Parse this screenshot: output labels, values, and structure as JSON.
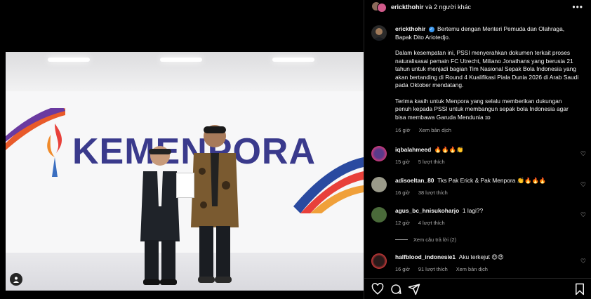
{
  "post": {
    "photo_brand_text": "KEMENPORA",
    "header": {
      "username": "erickthohir",
      "others_text": "và 2 người khác"
    },
    "caption": {
      "username": "erickthohir",
      "line1": "Bertemu dengan Menteri Pemuda dan Olahraga, Bapak Dito Ariotedjo.",
      "para2": "Dalam kesempatan ini, PSSI menyerahkan dokumen terkait proses naturalisasai pemain FC Utrecht, Miliano Jonathans yang berusia 21 tahun untuk menjadi bagian Tim Nasional Sepak Bola Indonesia yang akan bertanding di Round 4 Kualifikasi Piala Dunia 2026 di Arab Saudi pada Oktober mendatang.",
      "para3": "Terima kasih untuk Menpora yang selalu memberikan dukungan penuh kepada PSSI untuk membangun sepak bola Indonesia agar bisa membawa Garuda Mendunia ɪᴅ",
      "time": "16 giờ",
      "translate": "Xem bản dịch"
    }
  },
  "comments": [
    {
      "username": "iqbalahmeed",
      "text": "🔥🔥🔥👏",
      "time": "15 giờ",
      "likes": "5 lượt thích",
      "translate": ""
    },
    {
      "username": "adisoeltan_80",
      "text": "Tks Pak Erick & Pak Menpora 👏🔥🔥🔥",
      "time": "16 giờ",
      "likes": "38 lượt thích",
      "translate": ""
    },
    {
      "username": "agus_bc_hnisukoharjo",
      "text": "1 lagi??",
      "time": "12 giờ",
      "likes": "4 lượt thích",
      "translate": ""
    },
    {
      "username": "halfblood_indonesie1",
      "text": "Aku terkejut 😍😍",
      "time": "16 giờ",
      "likes": "91 lượt thích",
      "translate": "Xem bản dịch"
    }
  ],
  "replies": {
    "view_replies": "Xem câu trả lời (2)"
  },
  "icons": [
    "heart-icon",
    "comment-icon",
    "share-icon",
    "bookmark-icon",
    "more-icon",
    "user-tag-icon",
    "verified-badge-icon"
  ],
  "colors": {
    "accent": "#3897f0",
    "background": "#000000",
    "muted": "#a8a8a8",
    "brand": "#3a3a8c"
  }
}
